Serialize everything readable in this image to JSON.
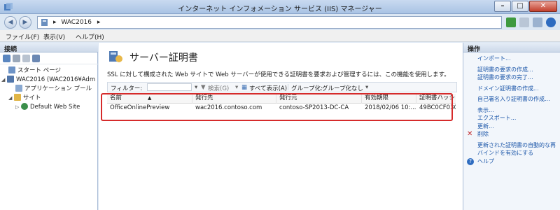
{
  "window": {
    "title": "インターネット インフォメーション サービス (IIS) マネージャー",
    "buttons": {
      "minimize": "–",
      "maximize": "□",
      "close": "✕"
    }
  },
  "address": {
    "path": "WAC2016",
    "separator": "▸"
  },
  "menu": {
    "items": [
      "ファイル(F)",
      "表示(V)",
      "ヘルプ(H)"
    ]
  },
  "connections": {
    "header": "接続",
    "tree": [
      {
        "label": "スタート ページ",
        "icon": "start-page-icon"
      },
      {
        "label": "WAC2016 (WAC2016¥Adm",
        "icon": "server-icon"
      },
      {
        "label": "アプリケーション プール",
        "icon": "app-pool-icon"
      },
      {
        "label": "サイト",
        "icon": "sites-folder-icon"
      },
      {
        "label": "Default Web Site",
        "icon": "website-icon"
      }
    ]
  },
  "main": {
    "title": "サーバー証明書",
    "description": "SSL に対して構成された Web サイトで Web サーバーが使用できる証明書を要求および管理するには、この機能を使用します。",
    "filter": {
      "label": "フィルター:",
      "search": "検索(G)",
      "show_all": "すべて表示(A)",
      "group_by": "グループ化:",
      "group_value": "グループ化なし"
    },
    "columns": [
      "名前",
      "発行先",
      "発行元",
      "有効期限",
      "証明書ハッシュ"
    ],
    "rows": [
      {
        "name": "OfficeOnlinePreview",
        "issued_to": "wac2016.contoso.com",
        "issued_by": "contoso-SP2013-DC-CA",
        "expires": "2018/02/06 10:...",
        "hash": "49BC0CF030"
      }
    ]
  },
  "actions": {
    "header": "操作",
    "items": [
      "インポート...",
      "証明書の要求の作成...",
      "証明書の要求の完了...",
      "ドメイン証明書の作成...",
      "自己署名入り証明書の作成...",
      "表示...",
      "エクスポート...",
      "更新...",
      "削除",
      "更新された証明書の自動的な再バインドを有効にする",
      "ヘルプ"
    ]
  },
  "colors": {
    "accent": "#1a55a8",
    "highlight": "#d62b2b",
    "delete": "#c0282a"
  }
}
